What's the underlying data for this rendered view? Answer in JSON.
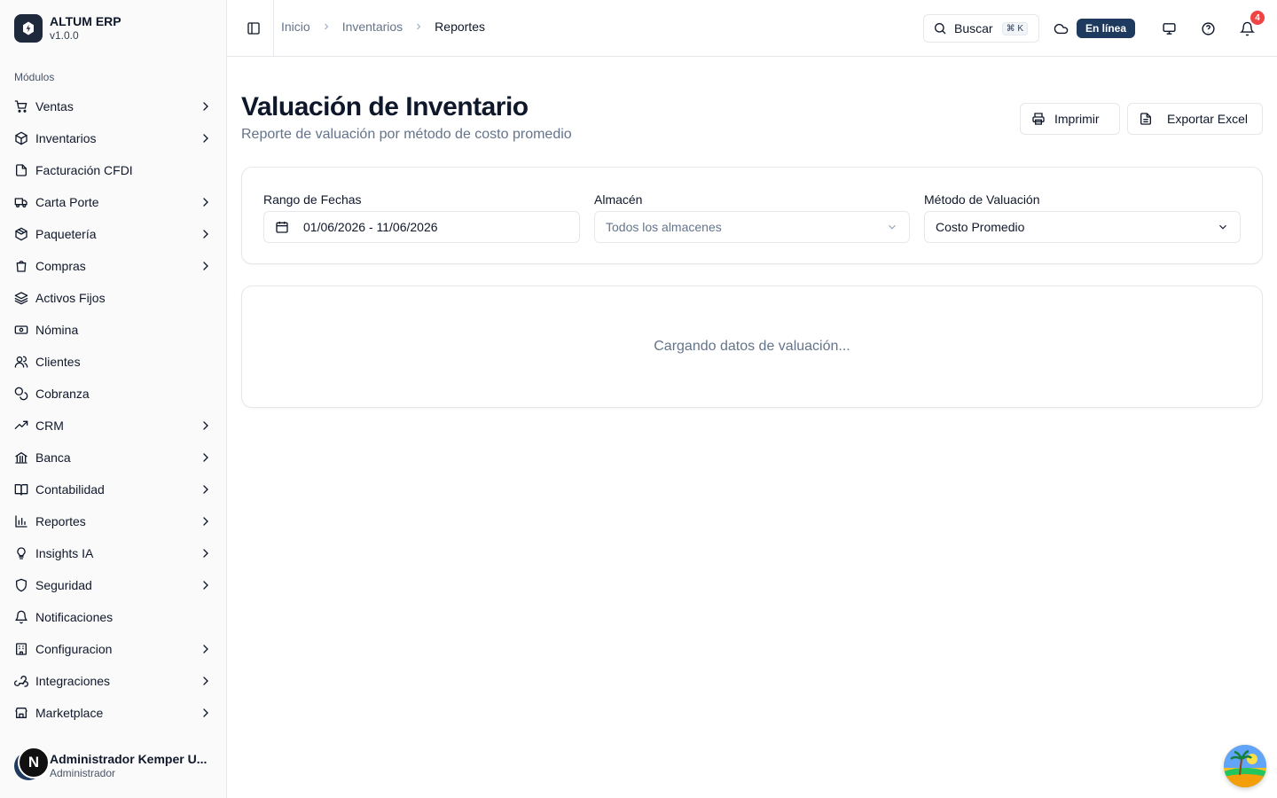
{
  "brand": {
    "name": "ALTUM ERP",
    "version": "v1.0.0"
  },
  "sidebar": {
    "section_label": "Módulos",
    "items": [
      {
        "label": "Ventas",
        "icon": "cart-icon",
        "expandable": true
      },
      {
        "label": "Inventarios",
        "icon": "package-icon",
        "expandable": true
      },
      {
        "label": "Facturación CFDI",
        "icon": "file-icon",
        "expandable": false
      },
      {
        "label": "Carta Porte",
        "icon": "truck-icon",
        "expandable": true
      },
      {
        "label": "Paquetería",
        "icon": "box-icon",
        "expandable": true
      },
      {
        "label": "Compras",
        "icon": "shopping-bag-icon",
        "expandable": true
      },
      {
        "label": "Activos Fijos",
        "icon": "layers-icon",
        "expandable": false
      },
      {
        "label": "Nómina",
        "icon": "banknote-icon",
        "expandable": false
      },
      {
        "label": "Clientes",
        "icon": "users-icon",
        "expandable": false
      },
      {
        "label": "Cobranza",
        "icon": "coins-icon",
        "expandable": false
      },
      {
        "label": "CRM",
        "icon": "trending-up-icon",
        "expandable": true
      },
      {
        "label": "Banca",
        "icon": "bank-icon",
        "expandable": true
      },
      {
        "label": "Contabilidad",
        "icon": "book-icon",
        "expandable": true
      },
      {
        "label": "Reportes",
        "icon": "bar-chart-icon",
        "expandable": true
      },
      {
        "label": "Insights IA",
        "icon": "lightbulb-icon",
        "expandable": true
      },
      {
        "label": "Seguridad",
        "icon": "shield-icon",
        "expandable": true
      },
      {
        "label": "Notificaciones",
        "icon": "bell-icon",
        "expandable": false
      },
      {
        "label": "Configuracion",
        "icon": "building-icon",
        "expandable": true
      },
      {
        "label": "Integraciones",
        "icon": "webhook-icon",
        "expandable": true
      },
      {
        "label": "Marketplace",
        "icon": "store-icon",
        "expandable": true
      }
    ]
  },
  "user": {
    "name": "Administrador Kemper U...",
    "role": "Administrador",
    "avatar_letter": "N"
  },
  "header": {
    "breadcrumbs": [
      "Inicio",
      "Inventarios",
      "Reportes"
    ],
    "search_label": "Buscar",
    "search_shortcut": "⌘ K",
    "status": "En línea",
    "notifications_count": "4"
  },
  "page": {
    "title": "Valuación de Inventario",
    "subtitle": "Reporte de valuación por método de costo promedio",
    "print_label": "Imprimir",
    "export_label": "Exportar Excel"
  },
  "filters": {
    "date_label": "Rango de Fechas",
    "date_value": "01/06/2026 - 11/06/2026",
    "warehouse_label": "Almacén",
    "warehouse_placeholder": "Todos los almacenes",
    "method_label": "Método de Valuación",
    "method_value": "Costo Promedio"
  },
  "loading_text": "Cargando datos de valuación..."
}
